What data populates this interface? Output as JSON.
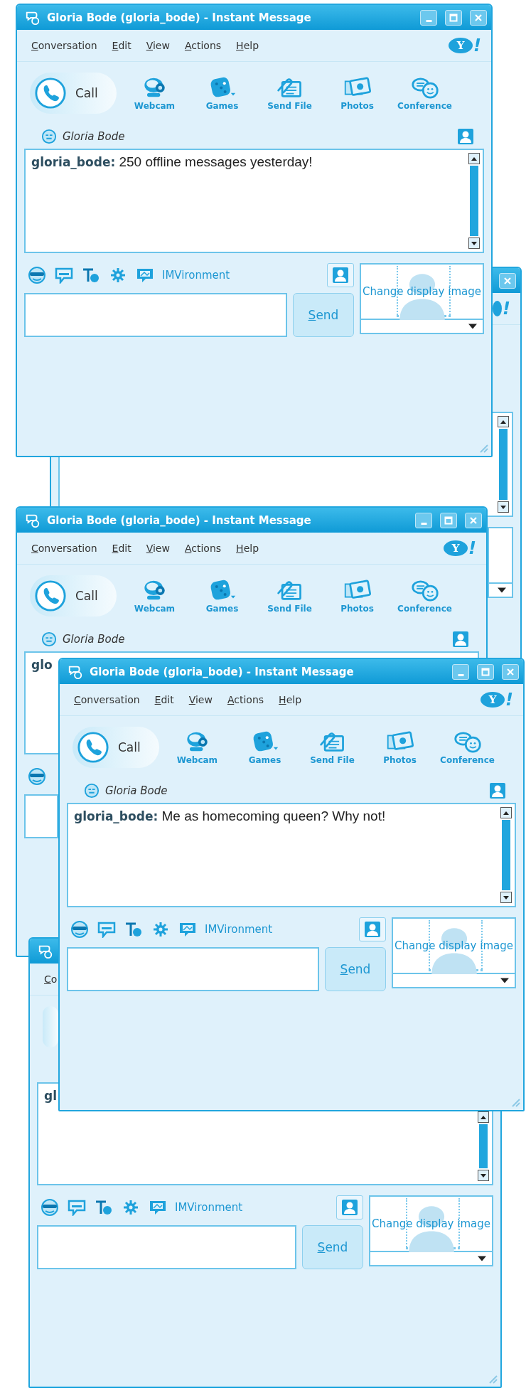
{
  "windows": [
    {
      "title": "Gloria Bode (gloria_bode) - Instant Message",
      "menu": [
        "Conversation",
        "Edit",
        "View",
        "Actions",
        "Help"
      ],
      "logo": {
        "badge": "Y",
        "mark": "!"
      },
      "call_label": "Call",
      "toolbar": [
        {
          "kind": "webcam",
          "label": "Webcam"
        },
        {
          "kind": "games",
          "label": "Games"
        },
        {
          "kind": "file",
          "label": "Send File"
        },
        {
          "kind": "photos",
          "label": "Photos"
        },
        {
          "kind": "conference",
          "label": "Conference"
        }
      ],
      "contact": "Gloria Bode",
      "message": {
        "sender": "gloria_bode:",
        "text": "250 offline messages yesterday!"
      },
      "tools_label": "IMVironment",
      "send_label": "Send",
      "display_image_label": "Change display image"
    },
    {
      "logo": {
        "mark": "!"
      }
    },
    {
      "title": "Gloria Bode (gloria_bode) - Instant Message",
      "menu": [
        "Conversation",
        "Edit",
        "View",
        "Actions",
        "Help"
      ],
      "logo": {
        "badge": "Y",
        "mark": "!"
      },
      "call_label": "Call",
      "toolbar": [
        {
          "kind": "webcam",
          "label": "Webcam"
        },
        {
          "kind": "games",
          "label": "Games"
        },
        {
          "kind": "file",
          "label": "Send File"
        },
        {
          "kind": "photos",
          "label": "Photos"
        },
        {
          "kind": "conference",
          "label": "Conference"
        }
      ],
      "contact": "Gloria Bode",
      "message": {
        "sender": "glo"
      }
    },
    {
      "title": "Gloria Bode (gloria_bode) - Instant Message",
      "menu": [
        "Conversation",
        "Edit",
        "View",
        "Actions",
        "Help"
      ],
      "logo": {
        "badge": "Y",
        "mark": "!"
      },
      "call_label": "Call",
      "toolbar": [
        {
          "kind": "webcam",
          "label": "Webcam"
        },
        {
          "kind": "games",
          "label": "Games"
        },
        {
          "kind": "file",
          "label": "Send File"
        },
        {
          "kind": "photos",
          "label": "Photos"
        },
        {
          "kind": "conference",
          "label": "Conference"
        }
      ],
      "contact": "Gloria Bode",
      "message": {
        "sender": "gloria_bode:",
        "text": "Me as homecoming queen? Why not!"
      },
      "tools_label": "IMVironment",
      "send_label": "Send",
      "display_image_label": "Change display image"
    },
    {
      "menu": [
        "Co"
      ],
      "message": {
        "sender": "gl"
      },
      "tools_label": "IMVironment",
      "send_label": "Send",
      "display_image_label": "Change display image"
    }
  ]
}
